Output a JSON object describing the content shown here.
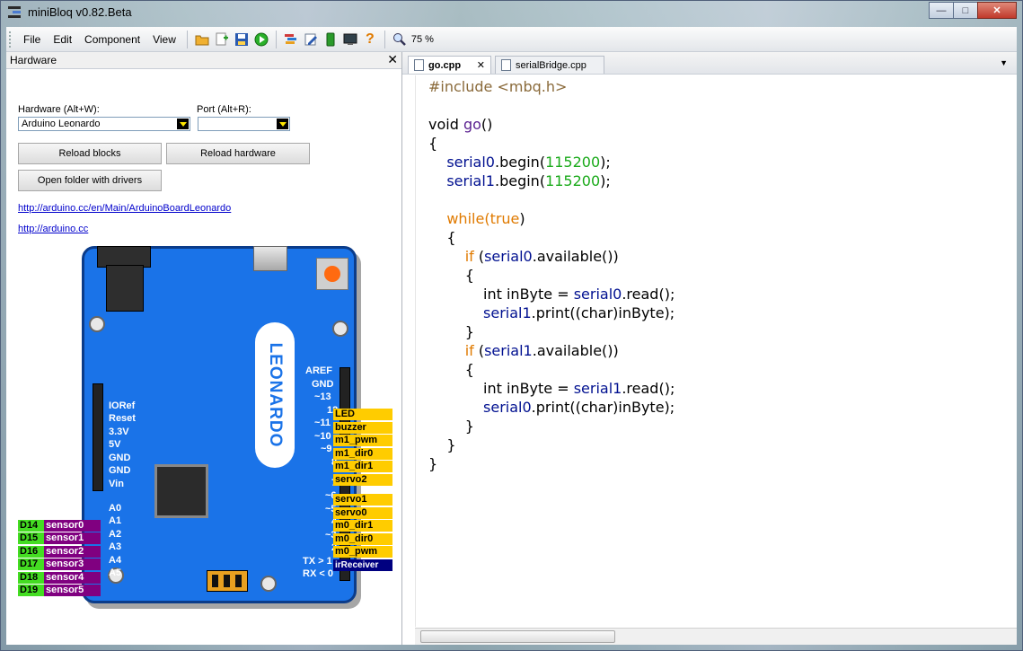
{
  "window": {
    "title": "miniBloq v0.82.Beta"
  },
  "menu": [
    "File",
    "Edit",
    "Component",
    "View"
  ],
  "toolbar": {
    "zoom": "75 %"
  },
  "hardware_panel": {
    "title": "Hardware",
    "hardware_label": "Hardware (Alt+W):",
    "hardware_value": "Arduino Leonardo",
    "port_label": "Port (Alt+R):",
    "port_value": "",
    "reload_blocks": "Reload blocks",
    "reload_hardware": "Reload hardware",
    "open_folder": "Open folder with drivers",
    "link1": "http://arduino.cc/en/Main/ArduinoBoardLeonardo",
    "link2": "http://arduino.cc"
  },
  "board": {
    "name": "LEONARDO",
    "left_pins": [
      "IORef",
      "Reset",
      "3.3V",
      "5V",
      "GND",
      "GND",
      "Vin"
    ],
    "analog_pins": [
      "A0",
      "A1",
      "A2",
      "A3",
      "A4",
      "A5"
    ],
    "digital_names": [
      "D14",
      "D15",
      "D16",
      "D17",
      "D18",
      "D19"
    ],
    "sensors": [
      "sensor0",
      "sensor1",
      "sensor2",
      "sensor3",
      "sensor4",
      "sensor5"
    ],
    "top_right_pins": [
      "AREF",
      "GND"
    ],
    "right_pins_1": [
      "~13",
      "12",
      "~11",
      "~10",
      "~9",
      "8"
    ],
    "right_tags_1": [
      "LED",
      "buzzer",
      "m1_pwm",
      "m1_dir0",
      "m1_dir1",
      "servo2"
    ],
    "right_pins_2": [
      "7",
      "~6",
      "~5",
      "4",
      "~3",
      "2",
      "TX > 1",
      "RX < 0"
    ],
    "right_tags_2": [
      "servo1",
      "servo0",
      "m0_dir1",
      "m0_dir0",
      "m0_pwm",
      "irReceiver"
    ]
  },
  "editor": {
    "tabs": [
      "go.cpp",
      "serialBridge.cpp"
    ],
    "code": [
      [
        [
          "pp",
          "#include <mbq.h>"
        ]
      ],
      [],
      [
        [
          "",
          "void "
        ],
        [
          "fn",
          "go"
        ],
        [
          "",
          "()"
        ]
      ],
      [
        [
          "",
          "{"
        ]
      ],
      [
        [
          "",
          "    "
        ],
        [
          "id",
          "serial0"
        ],
        [
          "",
          ".begin("
        ],
        [
          "nm",
          "115200"
        ],
        [
          "",
          ");"
        ]
      ],
      [
        [
          "",
          "    "
        ],
        [
          "id",
          "serial1"
        ],
        [
          "",
          ".begin("
        ],
        [
          "nm",
          "115200"
        ],
        [
          "",
          ");"
        ]
      ],
      [],
      [
        [
          "",
          "    "
        ],
        [
          "kw",
          "while"
        ],
        [
          "kw",
          "("
        ],
        [
          "kw",
          "true"
        ],
        [
          "",
          ")"
        ]
      ],
      [
        [
          "",
          "    {"
        ]
      ],
      [
        [
          "",
          "        "
        ],
        [
          "kw",
          "if"
        ],
        [
          "",
          " ("
        ],
        [
          "id",
          "serial0"
        ],
        [
          "",
          ".available())"
        ]
      ],
      [
        [
          "",
          "        {"
        ]
      ],
      [
        [
          "",
          "            int inByte = "
        ],
        [
          "id",
          "serial0"
        ],
        [
          "",
          ".read"
        ],
        [
          "",
          "();"
        ]
      ],
      [
        [
          "",
          "            "
        ],
        [
          "id",
          "serial1"
        ],
        [
          "",
          ".print((char)inByte);"
        ]
      ],
      [
        [
          "",
          "        }"
        ]
      ],
      [
        [
          "",
          "        "
        ],
        [
          "kw",
          "if"
        ],
        [
          "",
          " ("
        ],
        [
          "id",
          "serial1"
        ],
        [
          "",
          ".available())"
        ]
      ],
      [
        [
          "",
          "        {"
        ]
      ],
      [
        [
          "",
          "            int inByte = "
        ],
        [
          "id",
          "serial1"
        ],
        [
          "",
          ".read"
        ],
        [
          "",
          "();"
        ]
      ],
      [
        [
          "",
          "            "
        ],
        [
          "id",
          "serial0"
        ],
        [
          "",
          ".print((char)inByte);"
        ]
      ],
      [
        [
          "",
          "        }"
        ]
      ],
      [
        [
          "",
          "    }"
        ]
      ],
      [
        [
          "",
          "}"
        ]
      ]
    ]
  }
}
